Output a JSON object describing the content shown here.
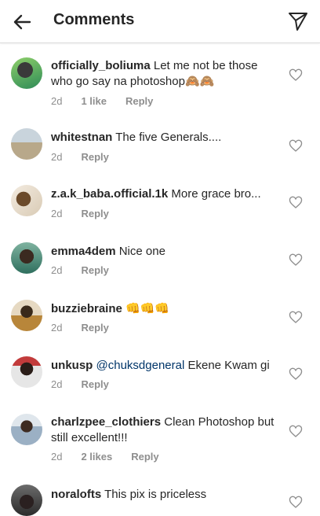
{
  "header": {
    "title": "Comments"
  },
  "comments": [
    {
      "username": "officially_boliuma",
      "text": "Let me not be those who go say na photoshop🙈🙈",
      "time": "2d",
      "likes": "1 like",
      "reply": "Reply",
      "avatar_color": "#4caf50"
    },
    {
      "username": "whitestnan",
      "text": "The five Generals....",
      "time": "2d",
      "likes": "",
      "reply": "Reply",
      "avatar_color": "#b0a595"
    },
    {
      "username": "z.a.k_baba.official.1k",
      "text": "More grace bro...",
      "time": "2d",
      "likes": "",
      "reply": "Reply",
      "avatar_color": "#e8dccc"
    },
    {
      "username": "emma4dem",
      "text": "Nice one",
      "time": "2d",
      "likes": "",
      "reply": "Reply",
      "avatar_color": "#3a7d6a"
    },
    {
      "username": "buzziebraine",
      "text": "👊👊👊",
      "time": "2d",
      "likes": "",
      "reply": "Reply",
      "avatar_color": "#8a6a3a"
    },
    {
      "username": "unkusp",
      "mention": "@chuksdgeneral",
      "text": "Ekene Kwam gi",
      "time": "2d",
      "likes": "",
      "reply": "Reply",
      "avatar_color": "#5a4a48"
    },
    {
      "username": "charlzpee_clothiers",
      "text": "Clean Photoshop but still excellent!!!",
      "time": "2d",
      "likes": "2 likes",
      "reply": "Reply",
      "avatar_color": "#9aaab8"
    },
    {
      "username": "noralofts",
      "text": "This pix is priceless",
      "time": "",
      "likes": "",
      "reply": "",
      "avatar_color": "#3a3a3a"
    }
  ]
}
